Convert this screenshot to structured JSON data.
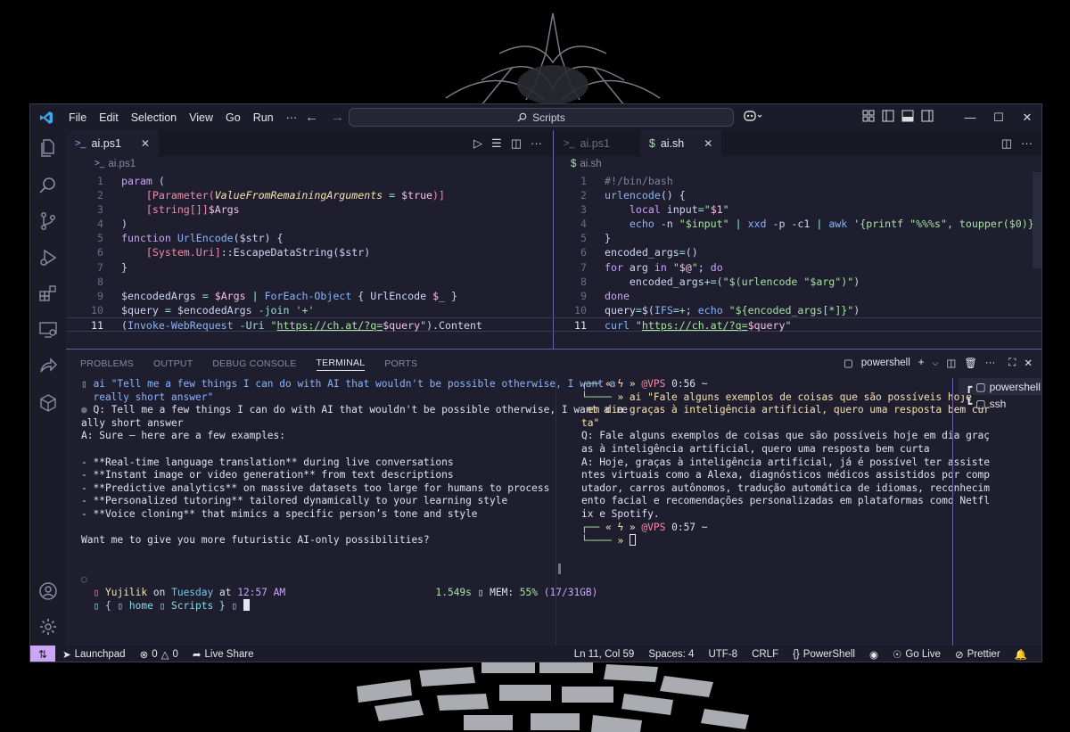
{
  "titlebar": {
    "menu": [
      "File",
      "Edit",
      "Selection",
      "View",
      "Go",
      "Run",
      "···"
    ],
    "search_label": "Scripts"
  },
  "editor_left": {
    "tab_label": "ai.ps1",
    "breadcrumb": "ai.ps1",
    "lines": [
      "1",
      "2",
      "3",
      "4",
      "5",
      "6",
      "7",
      "8",
      "9",
      "10",
      "11"
    ]
  },
  "editor_right": {
    "tab_inactive_label": "ai.ps1",
    "tab_label": "ai.sh",
    "breadcrumb": "ai.sh"
  },
  "panel": {
    "tabs": [
      "PROBLEMS",
      "OUTPUT",
      "DEBUG CONSOLE",
      "TERMINAL",
      "PORTS"
    ],
    "active_tab": "TERMINAL",
    "terminal_profile": "powershell",
    "terminal_list": [
      "powershell",
      "ssh"
    ]
  },
  "statusbar": {
    "launchpad": "Launchpad",
    "errors": "0",
    "warnings": "0",
    "live_share": "Live Share",
    "cursor_pos": "Ln 11, Col 59",
    "spaces": "Spaces: 4",
    "encoding": "UTF-8",
    "eol": "CRLF",
    "language": "PowerShell",
    "go_live": "Go Live",
    "prettier": "Prettier"
  },
  "colors": {
    "accent": "#cba6f7",
    "background": "#1e1e2e",
    "split_border": "#6c5fa8"
  }
}
